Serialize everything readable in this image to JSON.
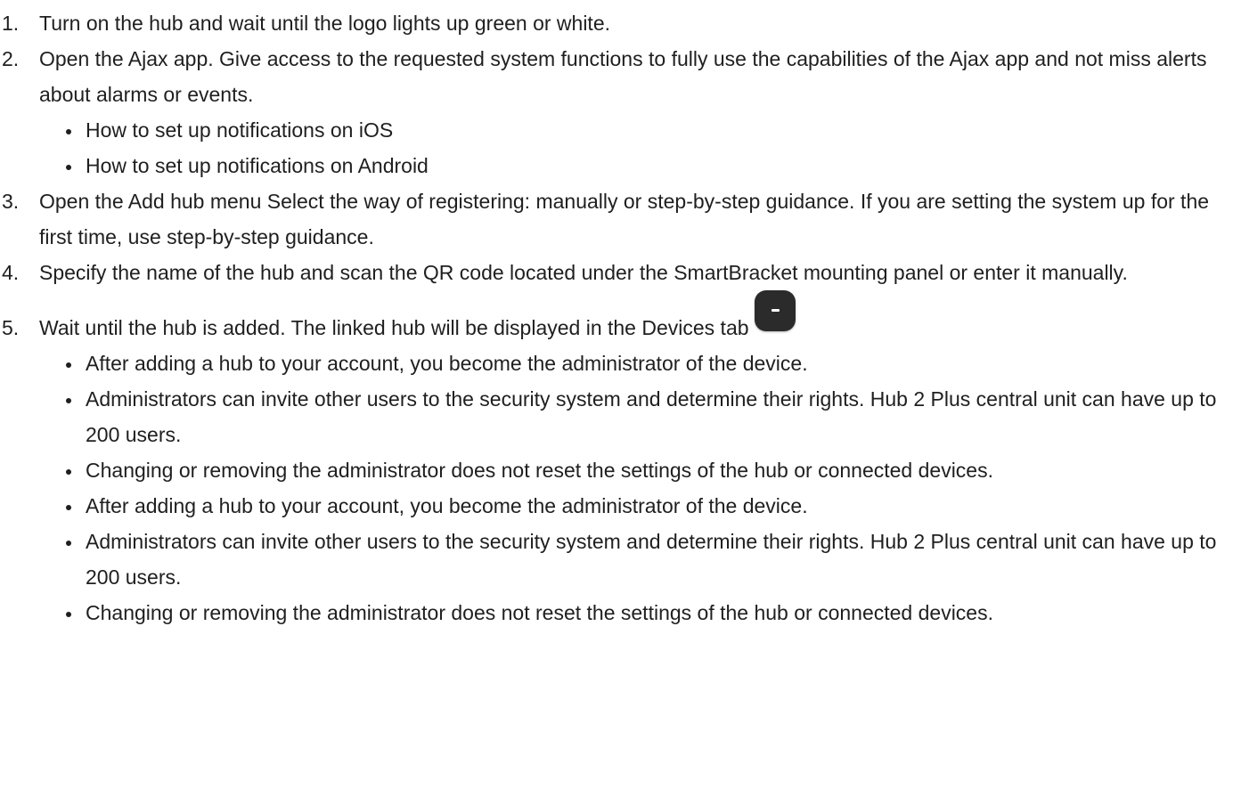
{
  "steps": [
    {
      "number": "1.",
      "text": "Turn on the hub and wait until the logo lights up green or white."
    },
    {
      "number": "2.",
      "text": "Open the Ajax app. Give access to the requested system functions to fully use the capabilities of the Ajax app and not miss alerts about alarms or events.",
      "bullets": [
        "How to set up notifications on iOS",
        "How to set up notifications on Android"
      ]
    },
    {
      "number": "3.",
      "text": "Open the Add hub menu Select the way of registering: manually or step-by-step guidance. If you are setting the system up for the first time, use step-by-step guidance."
    },
    {
      "number": "4.",
      "text": "Specify the name of the hub and scan the QR code located under the SmartBracket mounting panel or enter it manually."
    },
    {
      "number": "5.",
      "text": "Wait until the hub is added. The linked hub will be displayed in the Devices tab",
      "icon": "devices-tab-hub-icon",
      "bullets": [
        "After adding a hub to your account, you become the administrator of the device.",
        "Administrators can invite other users to the security system and determine their rights. Hub 2 Plus central unit can have up to 200 users.",
        "Changing or removing the administrator does not reset the settings of the hub or connected devices.",
        "After adding a hub to your account, you become the administrator of the device.",
        "Administrators can invite other users to the security system and determine their rights. Hub 2 Plus central unit can have up to 200 users.",
        "Changing or removing the administrator does not reset the settings of the hub or connected devices."
      ]
    }
  ]
}
